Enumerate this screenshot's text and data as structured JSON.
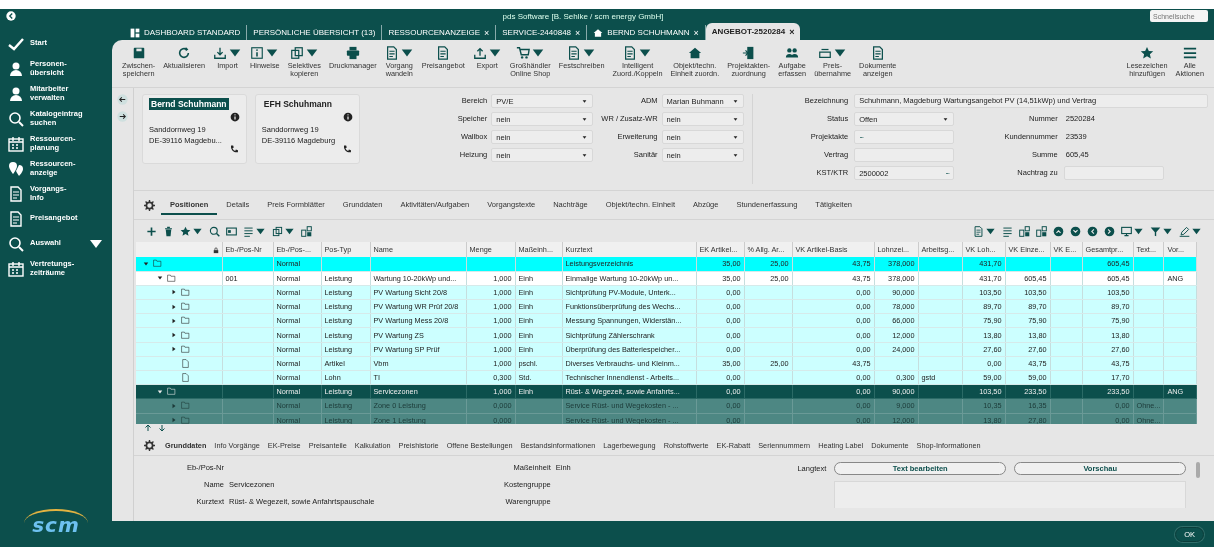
{
  "window": {
    "title": "pds Software [B. Sehlke / scm energy GmbH]",
    "search_placeholder": "Schnellsuche"
  },
  "tabs": [
    {
      "label": "DASHBOARD STANDARD",
      "kind": "dashboard",
      "selected": false
    },
    {
      "label": "PERSÖNLICHE ÜBERSICHT (13)",
      "kind": "plain",
      "selected": false
    },
    {
      "label": "RESSOURCENANZEIGE",
      "kind": "plain",
      "close": "×",
      "selected": false
    },
    {
      "label": "SERVICE-2440848",
      "kind": "plain",
      "close": "×",
      "selected": false
    },
    {
      "label": "BERND SCHUHMANN",
      "kind": "person",
      "close": "×",
      "selected": false
    },
    {
      "label": "ANGEBOT-2520284",
      "kind": "plain",
      "close": "×",
      "selected": true
    }
  ],
  "sidebar": {
    "items": [
      {
        "label": "Start",
        "has_menu": false
      },
      {
        "label": "Personen-\nübersicht",
        "has_menu": false
      },
      {
        "label": "Mitarbeiter\nverwalten",
        "has_menu": false
      },
      {
        "label": "Katalogeintrag\nsuchen",
        "has_menu": false
      },
      {
        "label": "Ressourcen-\nplanung",
        "has_menu": false
      },
      {
        "label": "Ressourcen-\nanzeige",
        "has_menu": false
      },
      {
        "label": "Vorgangs-\nInfo",
        "has_menu": false
      },
      {
        "label": "Preisangebot",
        "has_menu": false
      },
      {
        "label": "Auswahl",
        "has_menu": true
      },
      {
        "label": "Vertretungs-\nzeiträume",
        "has_menu": false
      }
    ],
    "logo": "scm"
  },
  "toolbar": {
    "buttons": [
      {
        "label": "Zwischen-\nspeichern",
        "dropdown": false
      },
      {
        "label": "Aktualisieren",
        "dropdown": false
      },
      {
        "label": "Import",
        "dropdown": true
      },
      {
        "label": "Hinweise",
        "dropdown": true
      },
      {
        "label": "Selektives\nkopieren",
        "dropdown": true
      },
      {
        "label": "Druckmanager",
        "dropdown": false
      },
      {
        "label": "Vorgang\nwandeln",
        "dropdown": true
      },
      {
        "label": "Preisangebot",
        "dropdown": false
      },
      {
        "label": "Export",
        "dropdown": true
      },
      {
        "label": "Großhändler\nOnline Shop",
        "dropdown": true
      },
      {
        "label": "Festschreiben",
        "dropdown": true
      },
      {
        "label": "Intelligent\nZuord./Koppeln",
        "dropdown": true
      },
      {
        "label": "Objekt/techn.\nEinheit zuordn.",
        "dropdown": false
      },
      {
        "label": "Projektakten-\nzuordnung",
        "dropdown": false
      },
      {
        "label": "Aufgabe\nerfassen",
        "dropdown": false
      },
      {
        "label": "Preis-\nübernahme",
        "dropdown": true
      },
      {
        "label": "Dokumente\nanzeigen",
        "dropdown": false
      }
    ],
    "right_buttons": [
      {
        "label": "Lesezeichen\nhinzufügen",
        "dropdown": false
      },
      {
        "label": "Alle\nAktionen",
        "dropdown": false
      }
    ]
  },
  "header": {
    "contacts": [
      {
        "name": "Bernd Schuhmann",
        "street": "Sanddornweg 19",
        "city": "DE-39116 Magdebu...",
        "selected": true
      },
      {
        "name": "EFH Schuhmann",
        "street": "Sanddornweg 19",
        "city": "DE-39116 Magdeburg",
        "selected": false
      }
    ],
    "fields_left": [
      {
        "label": "Bereich",
        "value": "PV/E"
      },
      {
        "label": "Speicher",
        "value": "nein"
      },
      {
        "label": "Wallbox",
        "value": "nein"
      },
      {
        "label": "Heizung",
        "value": "nein"
      }
    ],
    "fields_mid": [
      {
        "label": "ADM",
        "value": "Marian Buhmann"
      },
      {
        "label": "WR / Zusatz-WR",
        "value": "nein"
      },
      {
        "label": "Erweiterung",
        "value": "nein"
      },
      {
        "label": "Sanitär",
        "value": "nein"
      }
    ],
    "description": {
      "label": "Bezeichnung",
      "value": "Schuhmann, Magdeburg Wartungsangebot PV (14,51kWp) und Vertrag"
    },
    "fields_right": [
      {
        "label": "Status",
        "value": "Offen",
        "kind": "dropdown"
      },
      {
        "label": "Projektakte",
        "kind": "lookup",
        "action": "···"
      },
      {
        "label": "Vertrag",
        "kind": "text"
      },
      {
        "label": "KST/KTR",
        "value": "2500002",
        "kind": "lookup",
        "action": "···"
      }
    ],
    "info": [
      {
        "label": "Nummer",
        "value": "2520284",
        "kind": "text"
      },
      {
        "label": "Kundennummer",
        "value": "23539",
        "kind": "text"
      },
      {
        "label": "Summe",
        "value": "605,45",
        "kind": "text"
      },
      {
        "label": "Nachtrag zu",
        "kind": "field"
      }
    ]
  },
  "position_tabs": [
    {
      "label": "Positionen",
      "selected": true
    },
    {
      "label": "Details",
      "selected": false
    },
    {
      "label": "Preis Formblätter",
      "selected": false
    },
    {
      "label": "Grunddaten",
      "selected": false
    },
    {
      "label": "Aktivitäten/Aufgaben",
      "selected": false
    },
    {
      "label": "Vorgangstexte",
      "selected": false
    },
    {
      "label": "Nachträge",
      "selected": false
    },
    {
      "label": "Objekt/techn. Einheit",
      "selected": false
    },
    {
      "label": "Abzüge",
      "selected": false
    },
    {
      "label": "Stundenerfassung",
      "selected": false
    },
    {
      "label": "Tätigkeiten",
      "selected": false
    }
  ],
  "table": {
    "columns": [
      "Eb-/Pos-Nr",
      "Eb-/Pos-...",
      "Pos-Typ",
      "Name",
      "Menge",
      "Maßeinh...",
      "Kurztext",
      "EK Artikel...",
      "% Allg. Ar...",
      "VK Artikel-Basis",
      "Lohnzei...",
      "Arbeitsg...",
      "VK Loh...",
      "VK Einze...",
      "VK E...",
      "Gesamtpr...",
      "Text...",
      "Vor..."
    ],
    "rows": [
      {
        "kind": "group",
        "expanded": true,
        "selected": false,
        "cells": [
          "",
          "Normal",
          "",
          "",
          "",
          "",
          "Leistungsverzeichnis",
          "35,00",
          "25,00",
          "43,75",
          "378,000",
          "",
          "431,70",
          "",
          "",
          "605,45",
          "",
          ""
        ],
        "children": [
          {
            "kind": "item",
            "expanded": true,
            "selected": false,
            "cells": [
              "001",
              "Normal",
              "Leistung",
              "Wartung 10-20kWp und...",
              "1,000",
              "Einh",
              "Einmalige Wartung 10-20kWp un...",
              "35,00",
              "25,00",
              "43,75",
              "378,000",
              "",
              "431,70",
              "605,45",
              "",
              "605,45",
              "",
              "ANG"
            ],
            "children": [
              {
                "kind": "child",
                "expanded": false,
                "selected": false,
                "cells": [
                  "",
                  "Normal",
                  "Leistung",
                  "PV Wartung Sicht 20/8",
                  "1,000",
                  "Einh",
                  "Sichtprüfung PV-Module, Unterk...",
                  "0,00",
                  "",
                  "0,00",
                  "90,000",
                  "",
                  "103,50",
                  "103,50",
                  "",
                  "103,50",
                  "",
                  ""
                ]
              },
              {
                "kind": "child",
                "expanded": false,
                "selected": false,
                "cells": [
                  "",
                  "Normal",
                  "Leistung",
                  "PV Wartung WR Prüf 20/8",
                  "1,000",
                  "Einh",
                  "Funktionsüberprüfung des Wechs...",
                  "0,00",
                  "",
                  "0,00",
                  "78,000",
                  "",
                  "89,70",
                  "89,70",
                  "",
                  "89,70",
                  "",
                  ""
                ]
              },
              {
                "kind": "child",
                "expanded": false,
                "selected": false,
                "cells": [
                  "",
                  "Normal",
                  "Leistung",
                  "PV Wartung Mess 20/8",
                  "1,000",
                  "Einh",
                  "Messung Spannungen, Widerstän...",
                  "0,00",
                  "",
                  "0,00",
                  "66,000",
                  "",
                  "75,90",
                  "75,90",
                  "",
                  "75,90",
                  "",
                  ""
                ]
              },
              {
                "kind": "child",
                "expanded": false,
                "selected": false,
                "cells": [
                  "",
                  "Normal",
                  "Leistung",
                  "PV Wartung ZS",
                  "1,000",
                  "Einh",
                  "Sichtprüfung Zählerschrank",
                  "0,00",
                  "",
                  "0,00",
                  "12,000",
                  "",
                  "13,80",
                  "13,80",
                  "",
                  "13,80",
                  "",
                  ""
                ]
              },
              {
                "kind": "child",
                "expanded": false,
                "selected": false,
                "cells": [
                  "",
                  "Normal",
                  "Leistung",
                  "PV Wartung SP Prüf",
                  "1,000",
                  "Einh",
                  "Überprüfung des Batteriespeicher...",
                  "0,00",
                  "",
                  "0,00",
                  "24,000",
                  "",
                  "27,60",
                  "27,60",
                  "",
                  "27,60",
                  "",
                  ""
                ]
              },
              {
                "kind": "child",
                "selected": false,
                "cells": [
                  "",
                  "Normal",
                  "Artikel",
                  "Vbm",
                  "1,000",
                  "pschl.",
                  "Diverses Verbrauchs- und Kleinm...",
                  "35,00",
                  "25,00",
                  "43,75",
                  "",
                  "",
                  "0,00",
                  "43,75",
                  "",
                  "43,75",
                  "",
                  ""
                ]
              },
              {
                "kind": "child",
                "selected": false,
                "cells": [
                  "",
                  "Normal",
                  "Lohn",
                  "TI",
                  "0,300",
                  "Std.",
                  "Technischer Innendienst - Arbeits...",
                  "0,00",
                  "",
                  "0,00",
                  "0,300",
                  "gstd",
                  "59,00",
                  "59,00",
                  "",
                  "17,70",
                  "",
                  ""
                ]
              }
            ]
          },
          {
            "kind": "item",
            "expanded": true,
            "selected": true,
            "cells": [
              "",
              "Normal",
              "Leistung",
              "Servicezonen",
              "1,000",
              "Einh",
              "Rüst- & Wegezeit, sowie Anfahrts...",
              "0,00",
              "",
              "0,00",
              "90,000",
              "",
              "103,50",
              "233,50",
              "",
              "233,50",
              "",
              "ANG"
            ],
            "children": [
              {
                "kind": "sub",
                "expanded": false,
                "selected": false,
                "cells": [
                  "",
                  "Normal",
                  "Leistung",
                  "Zone 0 Leistung",
                  "0,000",
                  "",
                  "Service Rüst- und Wegekosten - ...",
                  "0,00",
                  "",
                  "0,00",
                  "9,000",
                  "",
                  "10,35",
                  "16,35",
                  "",
                  "0,00",
                  "Ohne...",
                  ""
                ]
              },
              {
                "kind": "sub",
                "expanded": false,
                "selected": false,
                "cells": [
                  "",
                  "Normal",
                  "Leistung",
                  "Zone 1 Leistung",
                  "0,000",
                  "",
                  "Service Rüst- und Wegekosten - ...",
                  "0,00",
                  "",
                  "0,00",
                  "12,000",
                  "",
                  "13,80",
                  "27,80",
                  "",
                  "0,00",
                  "Ohne...",
                  ""
                ]
              }
            ]
          }
        ]
      }
    ]
  },
  "detail_tabs": [
    {
      "label": "Grunddaten",
      "selected": true
    },
    {
      "label": "Info Vorgänge",
      "selected": false
    },
    {
      "label": "EK-Preise",
      "selected": false
    },
    {
      "label": "Preisanteile",
      "selected": false
    },
    {
      "label": "Kalkulation",
      "selected": false
    },
    {
      "label": "Preishistorie",
      "selected": false
    },
    {
      "label": "Offene Bestellungen",
      "selected": false
    },
    {
      "label": "Bestandsinformationen",
      "selected": false
    },
    {
      "label": "Lagerbewegung",
      "selected": false
    },
    {
      "label": "Rohstoffwerte",
      "selected": false
    },
    {
      "label": "EK-Rabatt",
      "selected": false
    },
    {
      "label": "Seriennummern",
      "selected": false
    },
    {
      "label": "Heating Label",
      "selected": false
    },
    {
      "label": "Dokumente",
      "selected": false
    },
    {
      "label": "Shop-Informationen",
      "selected": false
    }
  ],
  "detail": {
    "left": [
      {
        "label": "Eb-/Pos-Nr"
      },
      {
        "label": "Name",
        "value": "Servicezonen"
      },
      {
        "label": "Kurztext",
        "value": "Rüst- & Wegezeit, sowie Anfahrtspauschale"
      }
    ],
    "middle": [
      {
        "label": "Maßeinheit",
        "value": "Einh"
      },
      {
        "label": "Kostengruppe"
      },
      {
        "label": "Warengruppe"
      }
    ],
    "langtext_label": "Langtext",
    "buttons": [
      "Text bearbeiten",
      "Vorschau"
    ]
  },
  "ok_button": "OK"
}
